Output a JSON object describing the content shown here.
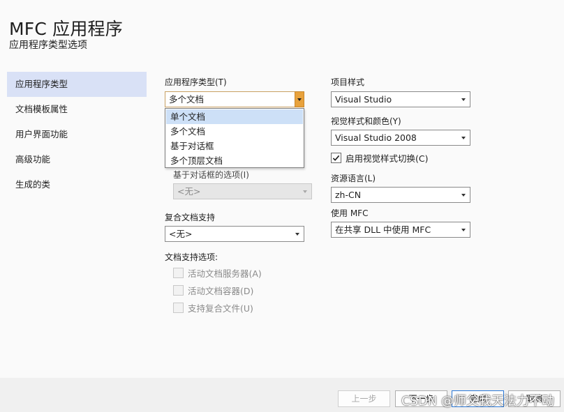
{
  "header": {
    "title": "MFC 应用程序",
    "subtitle": "应用程序类型选项"
  },
  "nav": {
    "items": [
      {
        "label": "应用程序类型",
        "active": true
      },
      {
        "label": "文档模板属性"
      },
      {
        "label": "用户界面功能"
      },
      {
        "label": "高级功能"
      },
      {
        "label": "生成的类"
      }
    ]
  },
  "left": {
    "app_type_label": "应用程序类型(T)",
    "app_type_value": "多个文档",
    "app_type_options": [
      "单个文档",
      "多个文档",
      "基于对话框",
      "多个顶层文档"
    ],
    "dialog_options_label": "基于对话框的选项(I)",
    "dialog_options_value": "<无>",
    "compound_label": "复合文档支持",
    "compound_value": "<无>",
    "doc_support_label": "文档支持选项:",
    "doc_support_options": [
      "活动文档服务器(A)",
      "活动文档容器(D)",
      "支持复合文件(U)"
    ]
  },
  "right": {
    "project_style_label": "项目样式",
    "project_style_value": "Visual Studio",
    "visual_style_label": "视觉样式和颜色(Y)",
    "visual_style_value": "Visual Studio 2008",
    "enable_switch_label": "启用视觉样式切换(C)",
    "enable_switch_checked": true,
    "resource_lang_label": "资源语言(L)",
    "resource_lang_value": "zh-CN",
    "use_mfc_label": "使用 MFC",
    "use_mfc_value": "在共享 DLL 中使用 MFC"
  },
  "footer": {
    "prev": "上一步",
    "next": "下一步",
    "finish": "完成",
    "cancel": "取消"
  },
  "watermark": "CSDN @师父我天法力不动"
}
